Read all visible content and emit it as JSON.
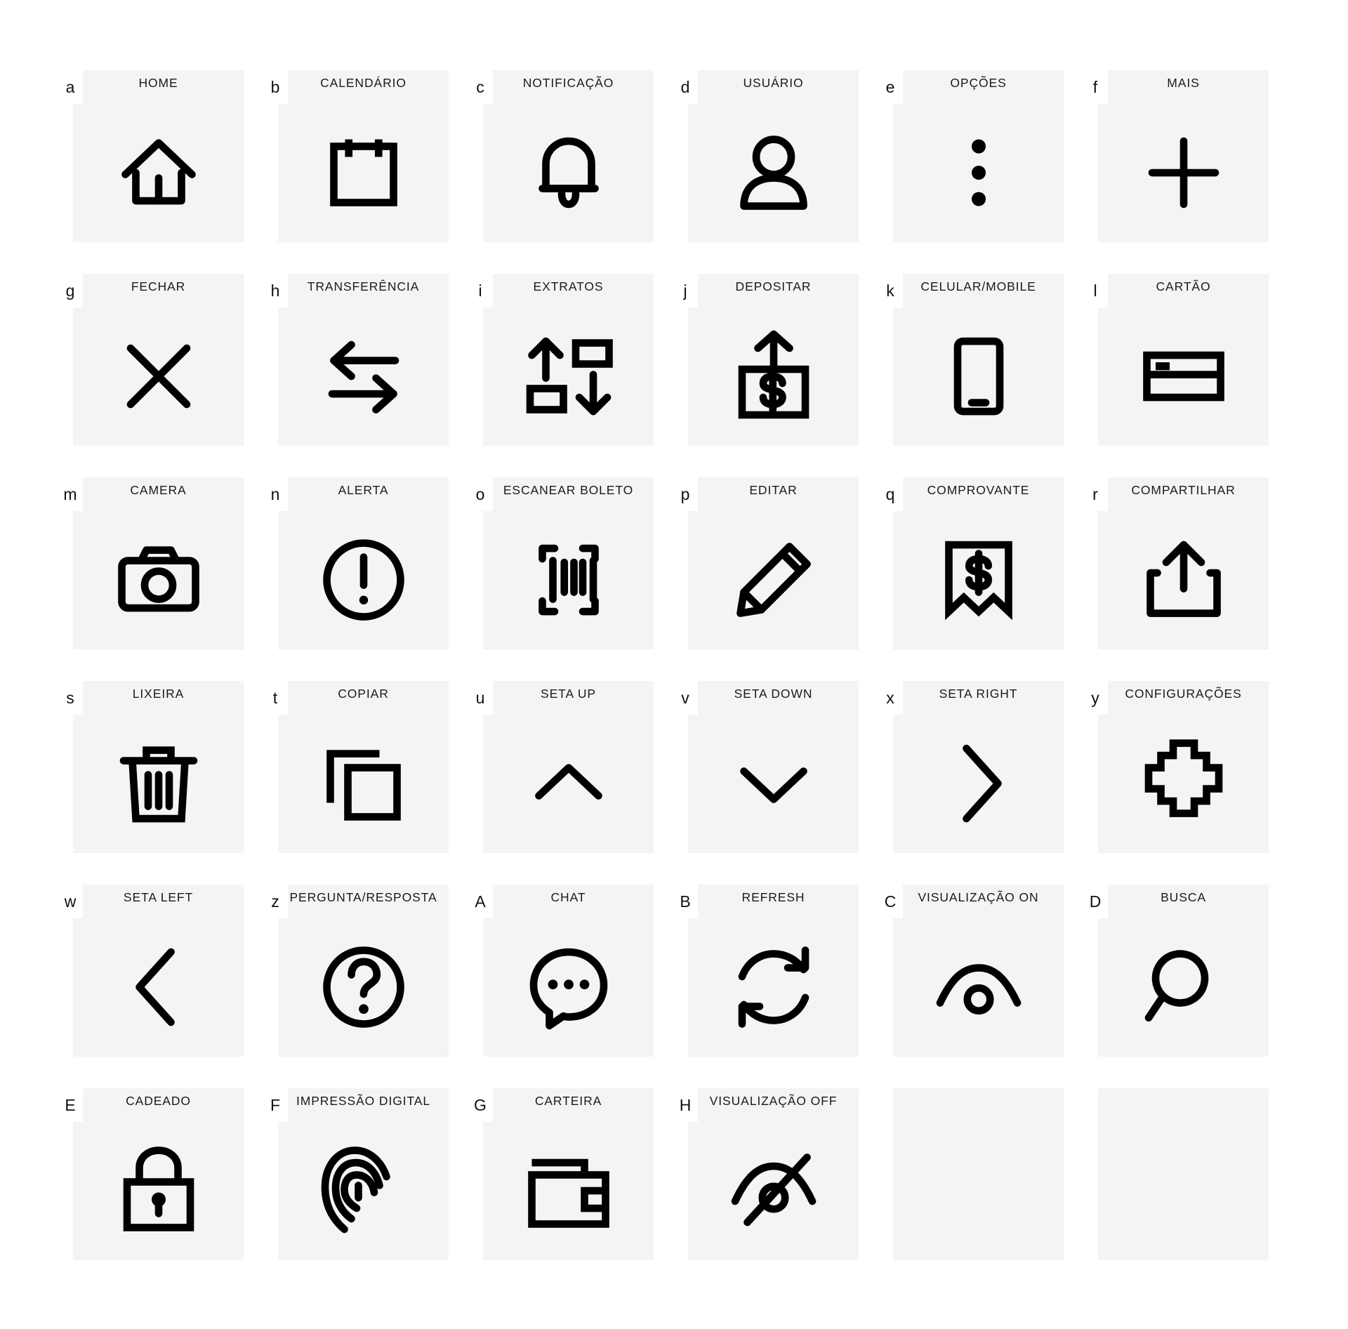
{
  "sheet": {
    "background": "#ffffff",
    "tile_background": "#f4f4f4",
    "icon_color": "#000000",
    "columns": 6,
    "rows": 6,
    "total_icons": 32
  },
  "icons": [
    {
      "key": "a",
      "label": "HOME",
      "icon": "home-icon"
    },
    {
      "key": "b",
      "label": "CALENDÁRIO",
      "icon": "calendar-icon"
    },
    {
      "key": "c",
      "label": "NOTIFICAÇÃO",
      "icon": "bell-icon"
    },
    {
      "key": "d",
      "label": "USUÁRIO",
      "icon": "user-icon"
    },
    {
      "key": "e",
      "label": "OPÇÕES",
      "icon": "kebab-menu-icon"
    },
    {
      "key": "f",
      "label": "MAIS",
      "icon": "plus-icon"
    },
    {
      "key": "g",
      "label": "FECHAR",
      "icon": "close-x-icon"
    },
    {
      "key": "h",
      "label": "TRANSFERÊNCIA",
      "icon": "transfer-arrows-icon"
    },
    {
      "key": "i",
      "label": "EXTRATOS",
      "icon": "statements-arrows-icon"
    },
    {
      "key": "j",
      "label": "DEPOSITAR",
      "icon": "deposit-icon"
    },
    {
      "key": "k",
      "label": "CELULAR/MOBILE",
      "icon": "smartphone-icon"
    },
    {
      "key": "l",
      "label": "CARTÃO",
      "icon": "credit-card-icon"
    },
    {
      "key": "m",
      "label": "CAMERA",
      "icon": "camera-icon"
    },
    {
      "key": "n",
      "label": "ALERTA",
      "icon": "alert-circle-icon"
    },
    {
      "key": "o",
      "label": "ESCANEAR BOLETO",
      "icon": "barcode-scan-icon"
    },
    {
      "key": "p",
      "label": "EDITAR",
      "icon": "pencil-icon"
    },
    {
      "key": "q",
      "label": "COMPROVANTE",
      "icon": "receipt-icon"
    },
    {
      "key": "r",
      "label": "COMPARTILHAR",
      "icon": "share-upload-icon"
    },
    {
      "key": "s",
      "label": "LIXEIRA",
      "icon": "trash-icon"
    },
    {
      "key": "t",
      "label": "COPIAR",
      "icon": "copy-icon"
    },
    {
      "key": "u",
      "label": "SETA UP",
      "icon": "chevron-up-icon"
    },
    {
      "key": "v",
      "label": "SETA DOWN",
      "icon": "chevron-down-icon"
    },
    {
      "key": "x",
      "label": "SETA RIGHT",
      "icon": "chevron-right-icon"
    },
    {
      "key": "y",
      "label": "CONFIGURAÇÕES",
      "icon": "gear-icon"
    },
    {
      "key": "w",
      "label": "SETA LEFT",
      "icon": "chevron-left-icon"
    },
    {
      "key": "z",
      "label": "PERGUNTA/RESPOSTA",
      "icon": "question-circle-icon"
    },
    {
      "key": "A",
      "label": "CHAT",
      "icon": "chat-bubble-icon"
    },
    {
      "key": "B",
      "label": "REFRESH",
      "icon": "refresh-icon"
    },
    {
      "key": "C",
      "label": "VISUALIZAÇÃO ON",
      "icon": "eye-on-icon"
    },
    {
      "key": "D",
      "label": "BUSCA",
      "icon": "search-icon"
    },
    {
      "key": "E",
      "label": "CADEADO",
      "icon": "lock-icon"
    },
    {
      "key": "F",
      "label": "IMPRESSÃO DIGITAL",
      "icon": "fingerprint-icon"
    },
    {
      "key": "G",
      "label": "CARTEIRA",
      "icon": "wallet-icon"
    },
    {
      "key": "H",
      "label": "VISUALIZAÇÃO OFF",
      "icon": "eye-off-icon"
    }
  ]
}
